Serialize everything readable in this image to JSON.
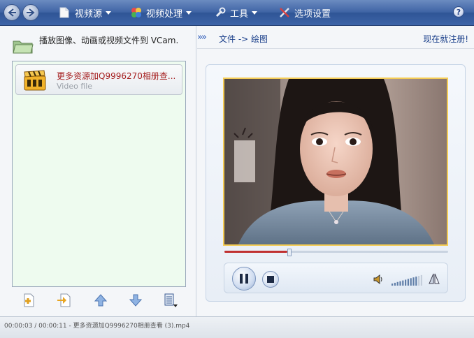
{
  "toolbar": {
    "menus": [
      {
        "label": "视频源",
        "icon": "document-icon"
      },
      {
        "label": "视频处理",
        "icon": "color-palette-icon"
      },
      {
        "label": "工具",
        "icon": "wrench-icon"
      },
      {
        "label": "选项设置",
        "icon": "tools-icon"
      }
    ],
    "help_label": "?"
  },
  "left_panel": {
    "header_text": "播放图像、动画或视频文件到 VCam.",
    "files": [
      {
        "title": "更多资源加Q9996270相册查...",
        "subtitle": "Video file",
        "icon": "film-clapper-icon"
      }
    ],
    "list_buttons": [
      "add-file-icon",
      "insert-file-icon",
      "move-up-icon",
      "move-down-icon",
      "list-menu-icon"
    ]
  },
  "right_panel": {
    "breadcrumb_arrows": "»»",
    "breadcrumb": "文件 -> 绘图",
    "register_link": "现在就注册!"
  },
  "player": {
    "progress_fraction": 0.28,
    "volume_level": 0.8,
    "controls": [
      "pause-icon",
      "stop-icon",
      "speaker-icon",
      "volume-bars",
      "flip-icon"
    ]
  },
  "status_bar": {
    "text": "00:00:03 / 00:00:11 - 更多资源加Q9996270相册查看 (3).mp4"
  },
  "colors": {
    "toolbar": "#3f64a5",
    "file_list_bg": "#eefbef",
    "file_title": "#a51f1f",
    "link": "#1a3f8a",
    "video_border": "#f4cc55",
    "progress_fill": "#c03030"
  }
}
